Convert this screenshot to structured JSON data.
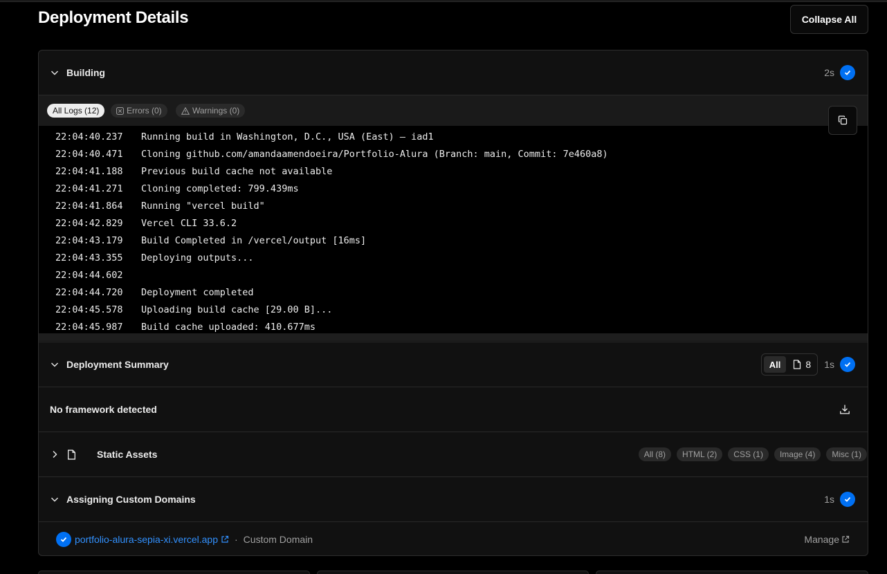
{
  "header": {
    "title": "Deployment Details",
    "collapse_label": "Collapse All"
  },
  "building": {
    "title": "Building",
    "duration": "2s",
    "tabs": {
      "all": "All Logs (12)",
      "errors": "Errors (0)",
      "warnings": "Warnings (0)"
    },
    "logs": [
      {
        "ts": "22:04:40.237",
        "msg": "Running build in Washington, D.C., USA (East) – iad1"
      },
      {
        "ts": "22:04:40.471",
        "msg": "Cloning github.com/amandaamendoeira/Portfolio-Alura (Branch: main, Commit: 7e460a8)"
      },
      {
        "ts": "22:04:41.188",
        "msg": "Previous build cache not available"
      },
      {
        "ts": "22:04:41.271",
        "msg": "Cloning completed: 799.439ms"
      },
      {
        "ts": "22:04:41.864",
        "msg": "Running \"vercel build\""
      },
      {
        "ts": "22:04:42.829",
        "msg": "Vercel CLI 33.6.2"
      },
      {
        "ts": "22:04:43.179",
        "msg": "Build Completed in /vercel/output [16ms]"
      },
      {
        "ts": "22:04:43.355",
        "msg": "Deploying outputs..."
      },
      {
        "ts": "22:04:44.602",
        "msg": ""
      },
      {
        "ts": "22:04:44.720",
        "msg": "Deployment completed"
      },
      {
        "ts": "22:04:45.578",
        "msg": "Uploading build cache [29.00 B]..."
      },
      {
        "ts": "22:04:45.987",
        "msg": "Build cache uploaded: 410.677ms"
      }
    ]
  },
  "summary": {
    "title": "Deployment Summary",
    "filter_all": "All",
    "file_count": "8",
    "duration": "1s",
    "framework": "No framework detected",
    "static_assets": {
      "title": "Static Assets",
      "pills": [
        "All (8)",
        "HTML (2)",
        "CSS (1)",
        "Image (4)",
        "Misc (1)"
      ]
    }
  },
  "domains": {
    "title": "Assigning Custom Domains",
    "duration": "1s",
    "domain": "portfolio-alura-sepia-xi.vercel.app",
    "separator": "·",
    "type": "Custom Domain",
    "manage_label": "Manage"
  },
  "colors": {
    "accent": "#0070f3",
    "link": "#3291ff",
    "background": "#000000",
    "panel": "#111111"
  },
  "icons": [
    "chevron-down-icon",
    "chevron-right-icon",
    "check-circle-icon",
    "copy-icon",
    "download-icon",
    "file-icon",
    "x-square-icon",
    "warning-triangle-icon",
    "external-link-icon"
  ]
}
